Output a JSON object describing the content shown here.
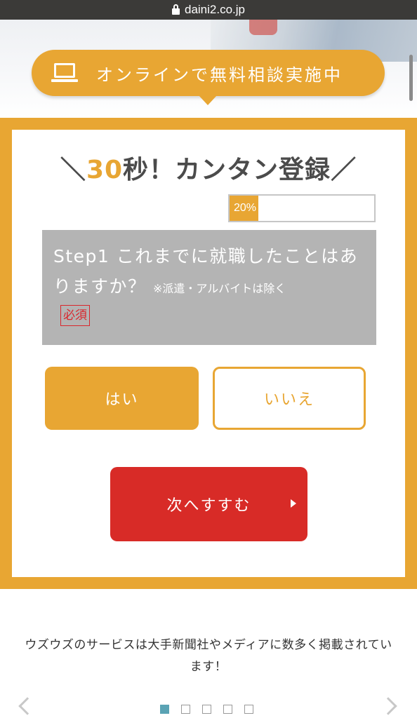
{
  "browser": {
    "url": "daini2.co.jp"
  },
  "banner": {
    "text": "オンラインで無料相談実施中",
    "icon": "laptop-icon"
  },
  "form": {
    "headline_prefix": "＼",
    "headline_number": "30",
    "headline_rest": "秒！カンタン登録",
    "headline_suffix": "／",
    "progress": {
      "label": "20%",
      "value": 0.2
    },
    "question": {
      "text": "Step1 これまでに就職したことはありますか？",
      "note": "※派遣・アルバイトは除く",
      "required_badge": "必須"
    },
    "yes_label": "はい",
    "no_label": "いいえ",
    "next_label": "次へすすむ"
  },
  "media": {
    "text": "ウズウズのサービスは大手新聞社やメディアに数多く掲載されています！"
  },
  "carousel": {
    "dot_count": 5,
    "active_index": 0
  },
  "colors": {
    "accent": "#e8a633",
    "primary_red": "#d82b27",
    "question_bg": "#b4b4b4",
    "dot_active": "#5aa3b4"
  }
}
